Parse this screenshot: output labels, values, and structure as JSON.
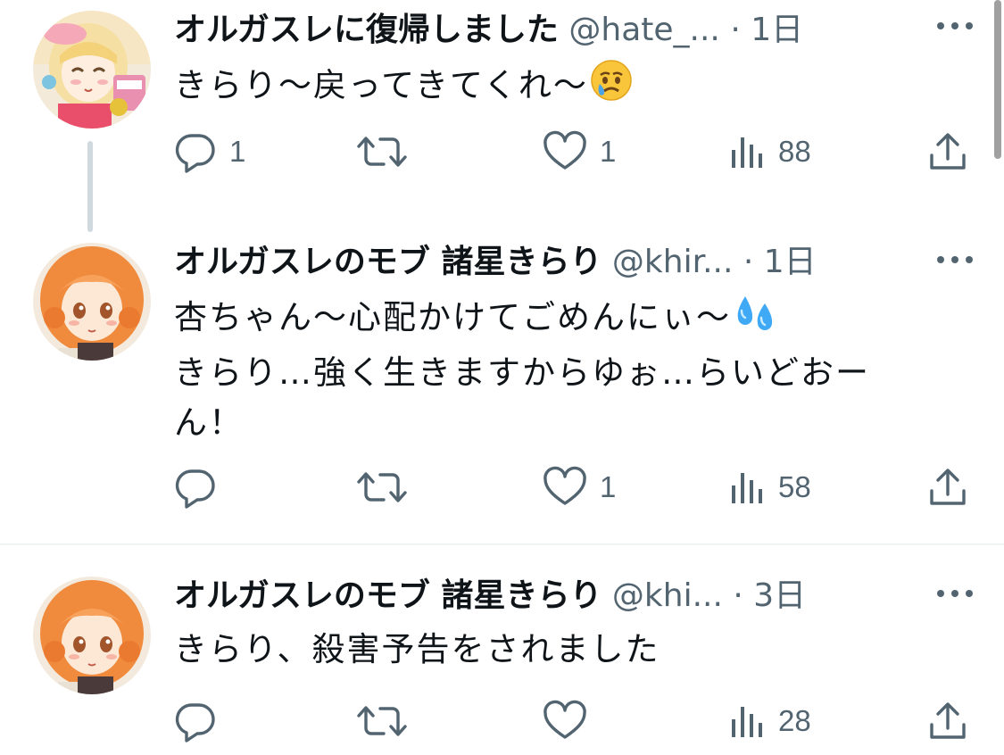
{
  "tweets": [
    {
      "display_name": "オルガスレに復帰しました",
      "handle": "@hate_...",
      "time": "1日",
      "lines": [
        "きらり〜戻ってきてくれ〜"
      ],
      "emoji": "crying-face-icon",
      "replies": "1",
      "retweets": "",
      "likes": "1",
      "views": "88"
    },
    {
      "display_name": "オルガスレのモブ 諸星きらり",
      "handle": "@khir...",
      "time": "1日",
      "lines": [
        "杏ちゃん〜心配かけてごめんにぃ〜",
        "きらり…強く生きますからゆぉ…らいどおー",
        "ん！"
      ],
      "emoji": "sweat-droplets-icon",
      "replies": "",
      "retweets": "",
      "likes": "1",
      "views": "58"
    },
    {
      "display_name": "オルガスレのモブ 諸星きらり",
      "handle": "@khi...",
      "time": "3日",
      "lines": [
        "きらり、殺害予告をされました"
      ],
      "replies": "",
      "retweets": "",
      "likes": "",
      "views": "28"
    }
  ],
  "separator": "·",
  "colors": {
    "text": "#0f1419",
    "muted": "#536471",
    "thread_line": "#cfd9de",
    "divider": "#eff3f4"
  }
}
